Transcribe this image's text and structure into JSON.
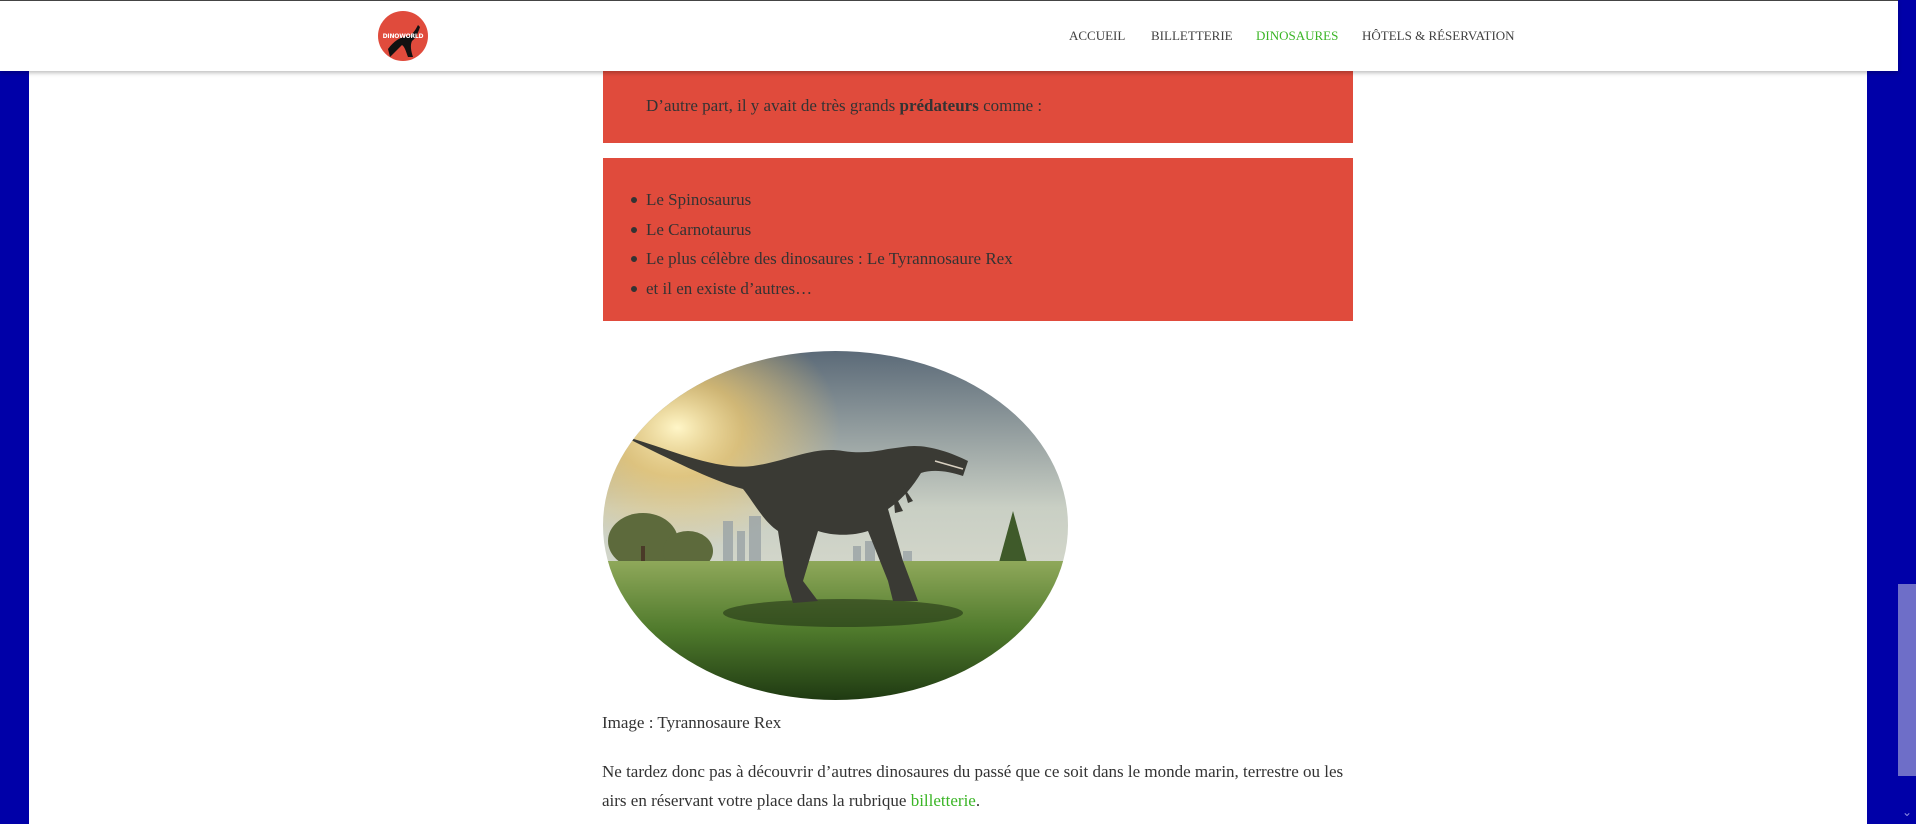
{
  "nav": {
    "logo_text": "DINOWORLD",
    "items": [
      {
        "label": "ACCUEIL",
        "active": false
      },
      {
        "label": "BILLETTERIE",
        "active": false
      },
      {
        "label": "DINOSAURES",
        "active": true
      },
      {
        "label": "HÔTELS & RÉSERVATION",
        "active": false
      }
    ]
  },
  "content": {
    "intro_before": "D’autre part, il y avait de très grands ",
    "intro_bold": "prédateurs",
    "intro_after": " comme :",
    "predators": [
      "Le Spinosaurus",
      "Le Carnotaurus",
      "Le plus célèbre des dinosaures : Le Tyrannosaure Rex",
      "et il en existe d’autres…"
    ],
    "image_caption": "Image : Tyrannosaure Rex",
    "closing_text": "Ne tardez donc pas à découvrir d’autres dinosaures du passé que ce soit dans le monde marin, terrestre ou les airs en réservant votre place dans la rubrique ",
    "closing_link": "billetterie",
    "closing_end": "."
  },
  "colors": {
    "accent_red": "#e04b3c",
    "link_green": "#3ab525",
    "background_blue": "#0000a8"
  }
}
